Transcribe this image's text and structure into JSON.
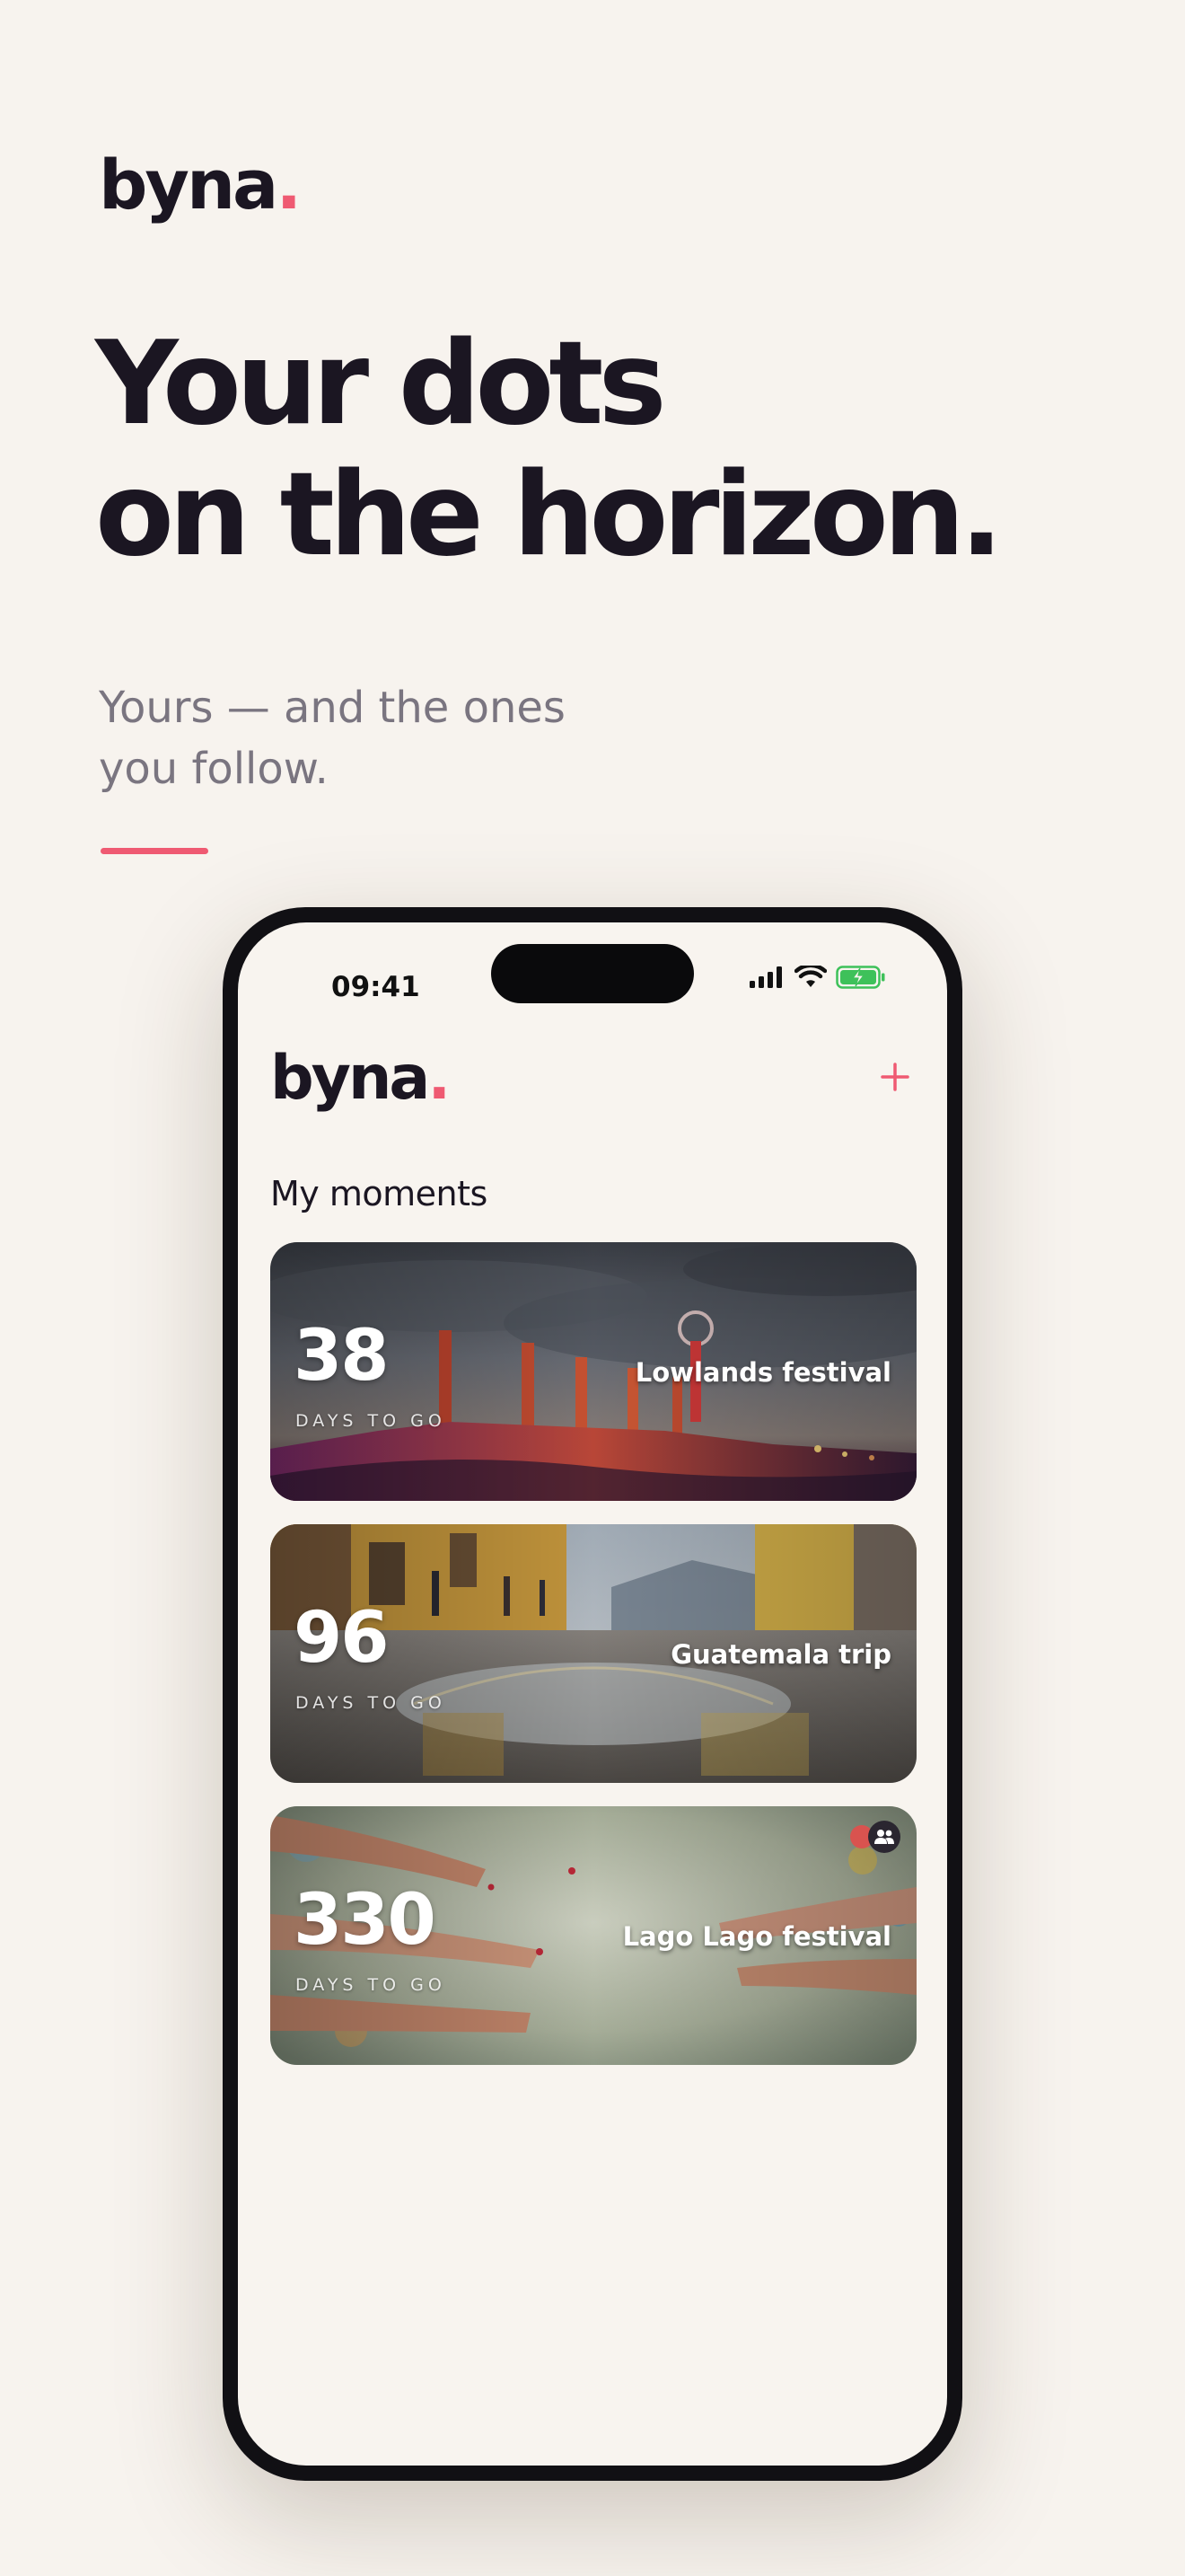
{
  "brand": {
    "name": "byna",
    "dot": "."
  },
  "hero": {
    "headline_line1": "Your dots",
    "headline_line2": "on the horizon.",
    "subtitle_line1": "Yours — and the ones",
    "subtitle_line2": "you follow."
  },
  "status_bar": {
    "time": "09:41",
    "icons": [
      "cellular-signal-icon",
      "wifi-icon",
      "battery-charging-icon"
    ]
  },
  "app": {
    "logo": "byna",
    "logo_dot": ".",
    "add_icon": "plus-icon",
    "section_title": "My moments"
  },
  "moments": [
    {
      "days": "38",
      "days_label": "DAYS TO GO",
      "title": "Lowlands festival"
    },
    {
      "days": "96",
      "days_label": "DAYS TO GO",
      "title": "Guatemala trip"
    },
    {
      "days": "330",
      "days_label": "DAYS TO GO",
      "title": "Lago Lago festival",
      "shared_icon": "group-icon"
    }
  ],
  "colors": {
    "background": "#f7f3ee",
    "accent": "#ef5a72",
    "ink": "#1b1622",
    "muted": "#7a7580",
    "battery": "#3ec15a"
  }
}
